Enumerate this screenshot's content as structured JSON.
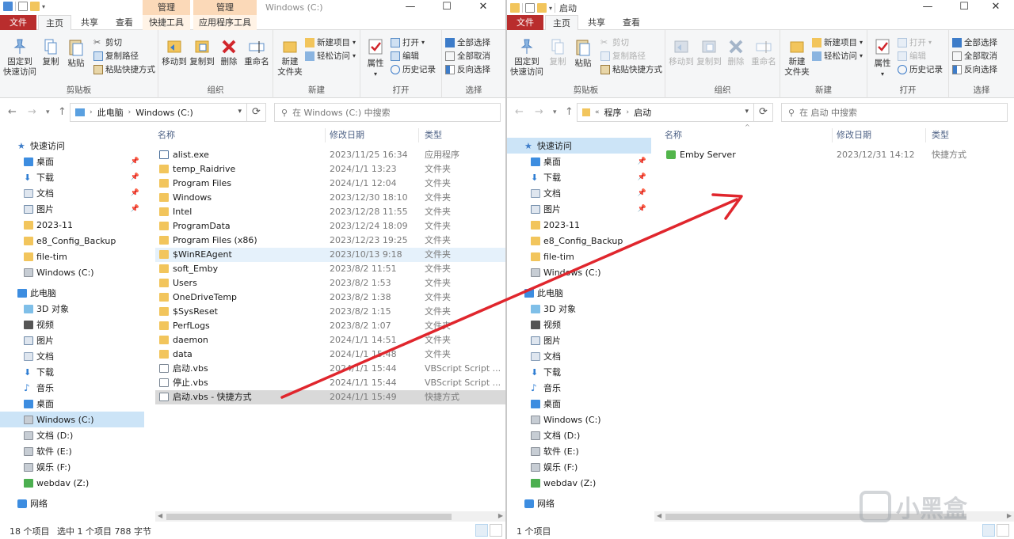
{
  "left": {
    "title": "Windows (C:)",
    "ctx_groups": [
      "管理",
      "管理"
    ],
    "tabs": [
      "文件",
      "主页",
      "共享",
      "查看",
      "快捷工具",
      "应用程序工具"
    ],
    "ribbon": {
      "clipboard": {
        "pin": "固定到\n快速访问",
        "copy": "复制",
        "paste": "粘贴",
        "cut": "剪切",
        "copypath": "复制路径",
        "pasteshortcut": "粘贴快捷方式",
        "label": "剪贴板"
      },
      "organize": {
        "moveto": "移动到",
        "copyto": "复制到",
        "delete": "删除",
        "rename": "重命名",
        "label": "组织"
      },
      "new": {
        "newfolder": "新建\n文件夹",
        "newitem": "新建项目",
        "easyaccess": "轻松访问",
        "label": "新建"
      },
      "open": {
        "properties": "属性",
        "open": "打开",
        "edit": "编辑",
        "history": "历史记录",
        "label": "打开"
      },
      "select": {
        "all": "全部选择",
        "none": "全部取消",
        "invert": "反向选择",
        "label": "选择"
      }
    },
    "address": {
      "root": "此电脑",
      "current": "Windows (C:)"
    },
    "search_placeholder": "在 Windows (C:) 中搜索",
    "columns": {
      "name": "名称",
      "date": "修改日期",
      "type": "类型"
    },
    "files": [
      {
        "name": "alist.exe",
        "date": "2023/11/25 16:34",
        "type": "应用程序",
        "kind": "exe"
      },
      {
        "name": "temp_Raidrive",
        "date": "2024/1/1 13:23",
        "type": "文件夹",
        "kind": "folder"
      },
      {
        "name": "Program Files",
        "date": "2024/1/1 12:04",
        "type": "文件夹",
        "kind": "folder"
      },
      {
        "name": "Windows",
        "date": "2023/12/30 18:10",
        "type": "文件夹",
        "kind": "folder"
      },
      {
        "name": "Intel",
        "date": "2023/12/28 11:55",
        "type": "文件夹",
        "kind": "folder"
      },
      {
        "name": "ProgramData",
        "date": "2023/12/24 18:09",
        "type": "文件夹",
        "kind": "folder"
      },
      {
        "name": "Program Files (x86)",
        "date": "2023/12/23 19:25",
        "type": "文件夹",
        "kind": "folder"
      },
      {
        "name": "$WinREAgent",
        "date": "2023/10/13 9:18",
        "type": "文件夹",
        "kind": "folder"
      },
      {
        "name": "soft_Emby",
        "date": "2023/8/2 11:51",
        "type": "文件夹",
        "kind": "folder"
      },
      {
        "name": "Users",
        "date": "2023/8/2 1:53",
        "type": "文件夹",
        "kind": "folder"
      },
      {
        "name": "OneDriveTemp",
        "date": "2023/8/2 1:38",
        "type": "文件夹",
        "kind": "folder"
      },
      {
        "name": "$SysReset",
        "date": "2023/8/2 1:15",
        "type": "文件夹",
        "kind": "folder"
      },
      {
        "name": "PerfLogs",
        "date": "2023/8/2 1:07",
        "type": "文件夹",
        "kind": "folder"
      },
      {
        "name": "daemon",
        "date": "2024/1/1 14:51",
        "type": "文件夹",
        "kind": "folder"
      },
      {
        "name": "data",
        "date": "2024/1/1 15:48",
        "type": "文件夹",
        "kind": "folder"
      },
      {
        "name": "启动.vbs",
        "date": "2024/1/1 15:44",
        "type": "VBScript Script ...",
        "kind": "vbs"
      },
      {
        "name": "停止.vbs",
        "date": "2024/1/1 15:44",
        "type": "VBScript Script ...",
        "kind": "vbs"
      },
      {
        "name": "启动.vbs - 快捷方式",
        "date": "2024/1/1 15:49",
        "type": "快捷方式",
        "kind": "shortcut"
      }
    ],
    "status": {
      "count": "18 个项目",
      "selected": "选中 1 个项目  788 字节"
    }
  },
  "right": {
    "title": "启动",
    "tabs": [
      "文件",
      "主页",
      "共享",
      "查看"
    ],
    "ribbon": {
      "clipboard": {
        "pin": "固定到\n快速访问",
        "copy": "复制",
        "paste": "粘贴",
        "cut": "剪切",
        "copypath": "复制路径",
        "pasteshortcut": "粘贴快捷方式",
        "label": "剪贴板"
      },
      "organize": {
        "moveto": "移动到",
        "copyto": "复制到",
        "delete": "删除",
        "rename": "重命名",
        "label": "组织"
      },
      "new": {
        "newfolder": "新建\n文件夹",
        "newitem": "新建项目",
        "easyaccess": "轻松访问",
        "label": "新建"
      },
      "open": {
        "properties": "属性",
        "open": "打开",
        "edit": "编辑",
        "history": "历史记录",
        "label": "打开"
      },
      "select": {
        "all": "全部选择",
        "none": "全部取消",
        "invert": "反向选择",
        "label": "选择"
      }
    },
    "address": {
      "prefix": "«",
      "parent": "程序",
      "current": "启动"
    },
    "search_placeholder": "在 启动 中搜索",
    "columns": {
      "name": "名称",
      "date": "修改日期",
      "type": "类型"
    },
    "files": [
      {
        "name": "Emby Server",
        "date": "2023/12/31 14:12",
        "type": "快捷方式",
        "kind": "emby"
      }
    ],
    "status": {
      "count": "1 个项目"
    }
  },
  "nav": [
    {
      "label": "快速访问",
      "icon": "star-icon",
      "level": 0
    },
    {
      "label": "桌面",
      "icon": "desktop-icon",
      "level": 1,
      "pinned": true
    },
    {
      "label": "下载",
      "icon": "download-icon",
      "level": 1,
      "pinned": true
    },
    {
      "label": "文档",
      "icon": "document-icon",
      "level": 1,
      "pinned": true
    },
    {
      "label": "图片",
      "icon": "picture-icon",
      "level": 1,
      "pinned": true
    },
    {
      "label": "2023-11",
      "icon": "folder-icon",
      "level": 1
    },
    {
      "label": "e8_Config_Backup",
      "icon": "folder-icon",
      "level": 1
    },
    {
      "label": "file-tim",
      "icon": "folder-icon",
      "level": 1
    },
    {
      "label": "Windows (C:)",
      "icon": "drive-icon",
      "level": 1
    },
    {
      "label": "此电脑",
      "icon": "computer-icon",
      "level": 0
    },
    {
      "label": "3D 对象",
      "icon": "3d-objects-icon",
      "level": 1
    },
    {
      "label": "视频",
      "icon": "video-icon",
      "level": 1
    },
    {
      "label": "图片",
      "icon": "picture-icon",
      "level": 1
    },
    {
      "label": "文档",
      "icon": "document-icon",
      "level": 1
    },
    {
      "label": "下载",
      "icon": "download-icon",
      "level": 1
    },
    {
      "label": "音乐",
      "icon": "music-icon",
      "level": 1
    },
    {
      "label": "桌面",
      "icon": "desktop-icon",
      "level": 1
    },
    {
      "label": "Windows (C:)",
      "icon": "drive-icon",
      "level": 1
    },
    {
      "label": "文档 (D:)",
      "icon": "drive-icon",
      "level": 1
    },
    {
      "label": "软件 (E:)",
      "icon": "drive-icon",
      "level": 1
    },
    {
      "label": "娱乐 (F:)",
      "icon": "drive-icon",
      "level": 1
    },
    {
      "label": "webdav (Z:)",
      "icon": "network-drive-icon",
      "level": 1
    },
    {
      "label": "网络",
      "icon": "network-icon",
      "level": 0
    }
  ],
  "window_controls": {
    "minimize": "—",
    "maximize": "☐",
    "close": "✕"
  },
  "watermark": "小黑盒",
  "colors": {
    "file_tab": "#b92d2d",
    "selection": "#cce4f7",
    "context_tab": "#fbd9b8",
    "folder": "#f2c55c",
    "arrow": "#e0262d",
    "accent": "#0078d7"
  }
}
